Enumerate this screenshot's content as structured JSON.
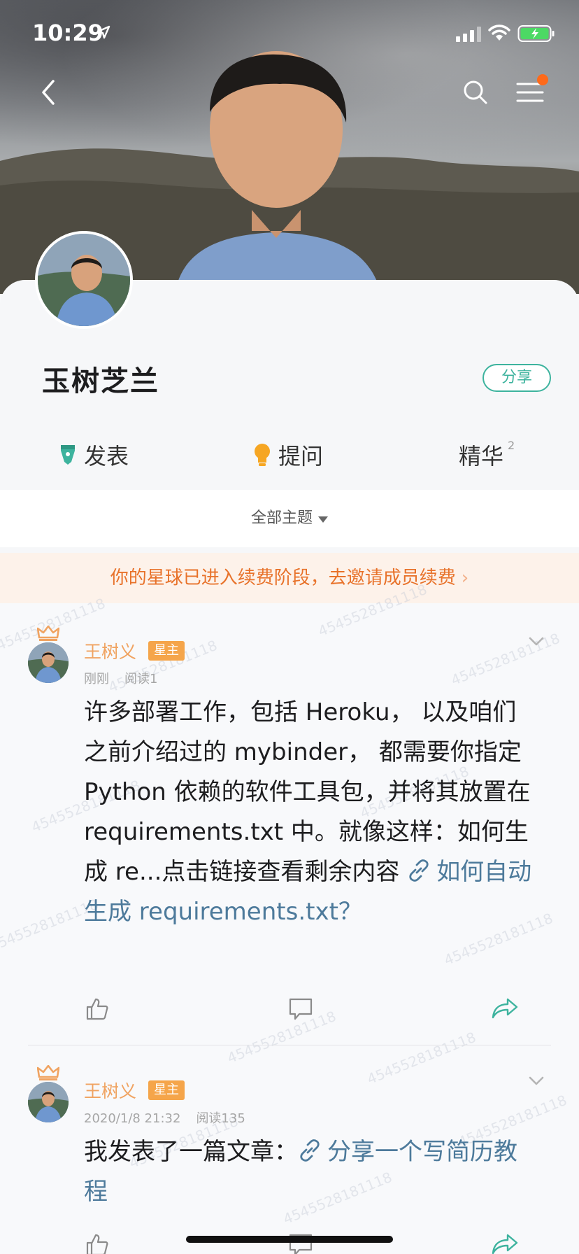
{
  "status_bar": {
    "time": "10:29"
  },
  "group": {
    "name": "玉树芝兰",
    "share_label": "分享"
  },
  "tabs": [
    {
      "label": "发表",
      "icon": "pen-icon",
      "color": "#3db39e"
    },
    {
      "label": "提问",
      "icon": "lightbulb-icon",
      "color": "#f6a623"
    },
    {
      "label": "精华",
      "count": "2"
    }
  ],
  "filter": {
    "label": "全部主题"
  },
  "renew_banner": {
    "text": "你的星球已进入续费阶段，去邀请成员续费",
    "chevron": "›"
  },
  "watermark": "4545528181118",
  "posts": [
    {
      "author": "王树义",
      "badge": "星主",
      "time": "刚刚",
      "reads": "阅读1",
      "body_text": "许多部署工作，包括 Heroku， 以及咱们之前介绍过的 mybinder， 都需要你指定 Python 依赖的软件工具包，并将其放置在 requirements.txt 中。就像这样：如何生成 re...点击链接查看剩余内容 ",
      "link_text": "如何自动生成 requirements.txt？"
    },
    {
      "author": "王树义",
      "badge": "星主",
      "time": "2020/1/8 21:32",
      "reads": "阅读135",
      "body_text": "我发表了一篇文章：",
      "link_text": "分享一个写简历教程"
    }
  ],
  "colors": {
    "accent": "#3db39e",
    "orange": "#e8722a",
    "author": "#f0a361",
    "link": "#4d7a9b"
  }
}
